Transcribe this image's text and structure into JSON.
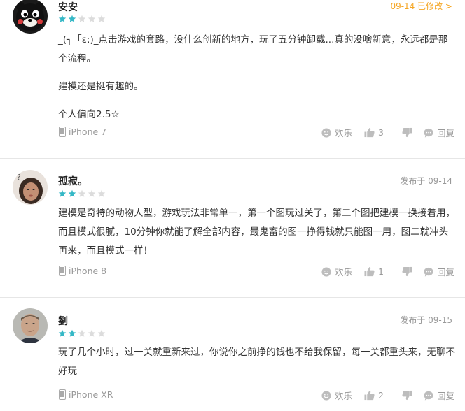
{
  "colors": {
    "star_filled": "#35b8c6",
    "star_empty": "#dcdcdc",
    "accent_date": "#f5a623",
    "meta": "#999999"
  },
  "reviews": [
    {
      "username": "安安",
      "rating": 2,
      "max_rating": 5,
      "date": "09-14 已修改 >",
      "paragraphs": [
        "_(┐「ε:)_点击游戏的套路，没什么创新的地方，玩了五分钟卸载...真的没啥新意，永远都是那个流程。",
        "建模还是挺有趣的。",
        "个人偏向2.5☆"
      ],
      "device": "iPhone 7",
      "fun_label": "欢乐",
      "like_count": "3",
      "reply_label": "回复"
    },
    {
      "username": "孤寂。",
      "rating": 2,
      "max_rating": 5,
      "date": "发布于 09-14",
      "paragraphs": [
        "建模是奇特的动物人型，游戏玩法非常单一，第一个图玩过关了，第二个图把建模一换接着用，而且模式很腻，10分钟你就能了解全部内容，最鬼畜的图一挣得钱就只能图一用，图二就冲头再来，而且模式一样！"
      ],
      "device": "iPhone 8",
      "fun_label": "欢乐",
      "like_count": "1",
      "reply_label": "回复"
    },
    {
      "username": "劉",
      "rating": 2,
      "max_rating": 5,
      "date": "发布于 09-15",
      "paragraphs": [
        "玩了几个小时，过一关就重新来过，你说你之前挣的钱也不给我保留，每一关都重头来，无聊不好玩"
      ],
      "device": "iPhone XR",
      "fun_label": "欢乐",
      "like_count": "2",
      "reply_label": "回复"
    }
  ]
}
